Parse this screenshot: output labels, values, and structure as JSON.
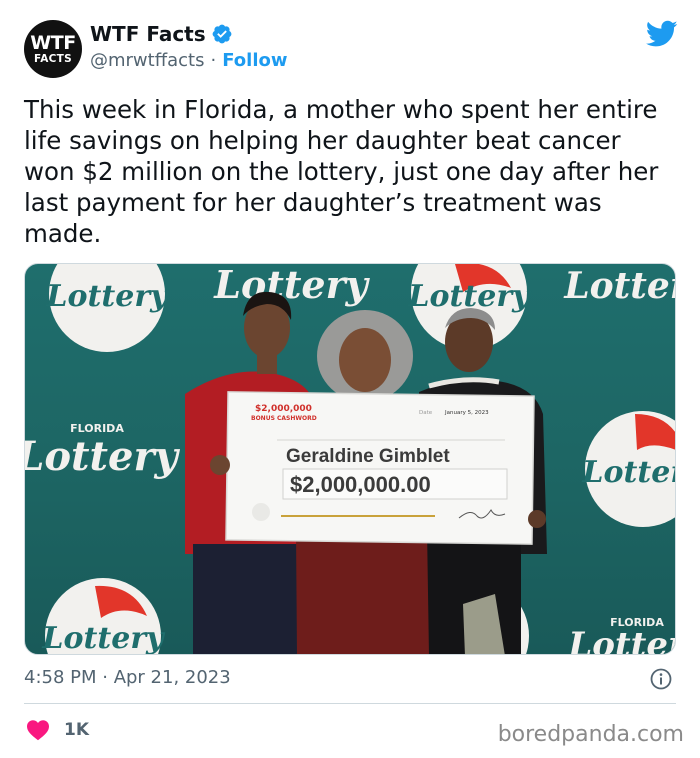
{
  "account": {
    "avatar_line1": "WTF",
    "avatar_line2": "FACTS",
    "display_name": "WTF Facts",
    "handle": "@mrwtffacts",
    "separator": "·",
    "follow_label": "Follow",
    "verified_icon": "verified-badge-icon",
    "platform_icon": "twitter-bird-icon"
  },
  "tweet": {
    "text": "This week in Florida, a mother who spent her entire life savings on helping her daughter beat cancer won $2 million on the lottery, just one day after her last payment for her daughter’s treatment was made.",
    "timestamp": "4:58 PM · Apr 21, 2023",
    "likes": "1K"
  },
  "media": {
    "check_header": "$2,000,000",
    "check_subheader": "BONUS CASHWORD",
    "check_date_label": "Date",
    "check_date": "January 5, 2023",
    "check_payee": "Geraldine Gimblet",
    "check_amount": "$2,000,000.00",
    "backdrop_brand": "Lottery",
    "backdrop_state": "FLORIDA"
  },
  "watermark": "boredpanda.com",
  "colors": {
    "accent_blue": "#1d9bf0",
    "like_pink": "#f91880",
    "muted_text": "#536471",
    "backdrop_teal": "#1f6e6d"
  }
}
